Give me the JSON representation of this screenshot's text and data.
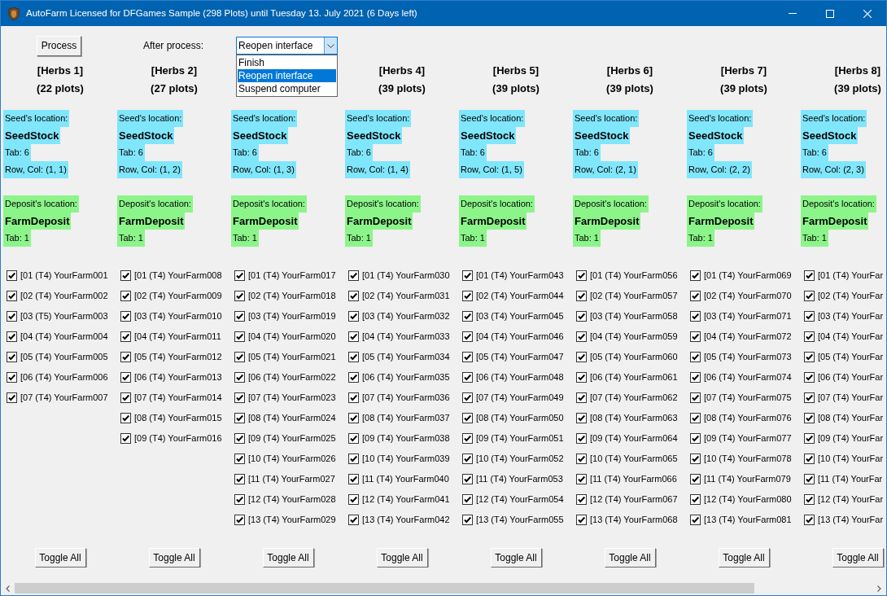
{
  "window": {
    "title": "AutoFarm Licensed for DFGames Sample (298 Plots) until Tuesday 13. July 2021 (6 Days left)"
  },
  "toolbar": {
    "process_button": "Process",
    "after_process_label": "After process:",
    "after_process_select": {
      "value": "Reopen interface",
      "expanded": true,
      "options": [
        {
          "label": "Finish",
          "selected": false
        },
        {
          "label": "Reopen interface",
          "selected": true
        },
        {
          "label": "Suspend computer",
          "selected": false
        }
      ]
    }
  },
  "columns": [
    {
      "title": "[Herbs 1]",
      "plots_count": "(22 plots)",
      "seed_location": {
        "label": "Seed's location:",
        "name": "SeedStock",
        "tab": "Tab: 6",
        "row_col": "Row, Col: (1, 1)"
      },
      "deposit_location": {
        "label": "Deposit's location:",
        "name": "FarmDeposit",
        "tab": "Tab: 1"
      },
      "plots": [
        {
          "label": "[01 (T4) YourFarm001",
          "checked": true
        },
        {
          "label": "[02 (T4) YourFarm002",
          "checked": true
        },
        {
          "label": "[03 (T5) YourFarm003",
          "checked": true
        },
        {
          "label": "[04 (T4) YourFarm004",
          "checked": true
        },
        {
          "label": "[05 (T4) YourFarm005",
          "checked": true
        },
        {
          "label": "[06 (T4) YourFarm006",
          "checked": true
        },
        {
          "label": "[07 (T4) YourFarm007",
          "checked": true
        }
      ],
      "toggle_button": "Toggle All"
    },
    {
      "title": "[Herbs 2]",
      "plots_count": "(27 plots)",
      "seed_location": {
        "label": "Seed's location:",
        "name": "SeedStock",
        "tab": "Tab: 6",
        "row_col": "Row, Col: (1, 2)"
      },
      "deposit_location": {
        "label": "Deposit's location:",
        "name": "FarmDeposit",
        "tab": "Tab: 1"
      },
      "plots": [
        {
          "label": "[01 (T4) YourFarm008",
          "checked": true
        },
        {
          "label": "[02 (T4) YourFarm009",
          "checked": true
        },
        {
          "label": "[03 (T4) YourFarm010",
          "checked": true
        },
        {
          "label": "[04 (T4) YourFarm011",
          "checked": true
        },
        {
          "label": "[05 (T4) YourFarm012",
          "checked": true
        },
        {
          "label": "[06 (T4) YourFarm013",
          "checked": true
        },
        {
          "label": "[07 (T4) YourFarm014",
          "checked": true
        },
        {
          "label": "[08 (T4) YourFarm015",
          "checked": true
        },
        {
          "label": "[09 (T4) YourFarm016",
          "checked": true
        }
      ],
      "toggle_button": "Toggle All"
    },
    {
      "seed_location": {
        "label": "Seed's location:",
        "name": "SeedStock",
        "tab": "Tab: 6",
        "row_col": "Row, Col: (1, 3)"
      },
      "deposit_location": {
        "label": "Deposit's location:",
        "name": "FarmDeposit",
        "tab": "Tab: 1"
      },
      "plots": [
        {
          "label": "[01 (T4) YourFarm017",
          "checked": true
        },
        {
          "label": "[02 (T4) YourFarm018",
          "checked": true
        },
        {
          "label": "[03 (T4) YourFarm019",
          "checked": true
        },
        {
          "label": "[04 (T4) YourFarm020",
          "checked": true
        },
        {
          "label": "[05 (T4) YourFarm021",
          "checked": true
        },
        {
          "label": "[06 (T4) YourFarm022",
          "checked": true
        },
        {
          "label": "[07 (T4) YourFarm023",
          "checked": true
        },
        {
          "label": "[08 (T4) YourFarm024",
          "checked": true
        },
        {
          "label": "[09 (T4) YourFarm025",
          "checked": true
        },
        {
          "label": "[10 (T4) YourFarm026",
          "checked": true
        },
        {
          "label": "[11 (T4) YourFarm027",
          "checked": true
        },
        {
          "label": "[12 (T4) YourFarm028",
          "checked": true
        },
        {
          "label": "[13 (T4) YourFarm029",
          "checked": true
        }
      ],
      "toggle_button": "Toggle All"
    },
    {
      "title": "[Herbs 4]",
      "plots_count": "(39 plots)",
      "seed_location": {
        "label": "Seed's location:",
        "name": "SeedStock",
        "tab": "Tab: 6",
        "row_col": "Row, Col: (1, 4)"
      },
      "deposit_location": {
        "label": "Deposit's location:",
        "name": "FarmDeposit",
        "tab": "Tab: 1"
      },
      "plots": [
        {
          "label": "[01 (T4) YourFarm030",
          "checked": true
        },
        {
          "label": "[02 (T4) YourFarm031",
          "checked": true
        },
        {
          "label": "[03 (T4) YourFarm032",
          "checked": true
        },
        {
          "label": "[04 (T4) YourFarm033",
          "checked": true
        },
        {
          "label": "[05 (T4) YourFarm034",
          "checked": true
        },
        {
          "label": "[06 (T4) YourFarm035",
          "checked": true
        },
        {
          "label": "[07 (T4) YourFarm036",
          "checked": true
        },
        {
          "label": "[08 (T4) YourFarm037",
          "checked": true
        },
        {
          "label": "[09 (T4) YourFarm038",
          "checked": true
        },
        {
          "label": "[10 (T4) YourFarm039",
          "checked": true
        },
        {
          "label": "[11 (T4) YourFarm040",
          "checked": true
        },
        {
          "label": "[12 (T4) YourFarm041",
          "checked": true
        },
        {
          "label": "[13 (T4) YourFarm042",
          "checked": true
        }
      ],
      "toggle_button": "Toggle All"
    },
    {
      "title": "[Herbs 5]",
      "plots_count": "(39 plots)",
      "seed_location": {
        "label": "Seed's location:",
        "name": "SeedStock",
        "tab": "Tab: 6",
        "row_col": "Row, Col: (1, 5)"
      },
      "deposit_location": {
        "label": "Deposit's location:",
        "name": "FarmDeposit",
        "tab": "Tab: 1"
      },
      "plots": [
        {
          "label": "[01 (T4) YourFarm043",
          "checked": true
        },
        {
          "label": "[02 (T4) YourFarm044",
          "checked": true
        },
        {
          "label": "[03 (T4) YourFarm045",
          "checked": true
        },
        {
          "label": "[04 (T4) YourFarm046",
          "checked": true
        },
        {
          "label": "[05 (T4) YourFarm047",
          "checked": true
        },
        {
          "label": "[06 (T4) YourFarm048",
          "checked": true
        },
        {
          "label": "[07 (T4) YourFarm049",
          "checked": true
        },
        {
          "label": "[08 (T4) YourFarm050",
          "checked": true
        },
        {
          "label": "[09 (T4) YourFarm051",
          "checked": true
        },
        {
          "label": "[10 (T4) YourFarm052",
          "checked": true
        },
        {
          "label": "[11 (T4) YourFarm053",
          "checked": true
        },
        {
          "label": "[12 (T4) YourFarm054",
          "checked": true
        },
        {
          "label": "[13 (T4) YourFarm055",
          "checked": true
        }
      ],
      "toggle_button": "Toggle All"
    },
    {
      "title": "[Herbs 6]",
      "plots_count": "(39 plots)",
      "seed_location": {
        "label": "Seed's location:",
        "name": "SeedStock",
        "tab": "Tab: 6",
        "row_col": "Row, Col: (2, 1)"
      },
      "deposit_location": {
        "label": "Deposit's location:",
        "name": "FarmDeposit",
        "tab": "Tab: 1"
      },
      "plots": [
        {
          "label": "[01 (T4) YourFarm056",
          "checked": true
        },
        {
          "label": "[02 (T4) YourFarm057",
          "checked": true
        },
        {
          "label": "[03 (T4) YourFarm058",
          "checked": true
        },
        {
          "label": "[04 (T4) YourFarm059",
          "checked": true
        },
        {
          "label": "[05 (T4) YourFarm060",
          "checked": true
        },
        {
          "label": "[06 (T4) YourFarm061",
          "checked": true
        },
        {
          "label": "[07 (T4) YourFarm062",
          "checked": true
        },
        {
          "label": "[08 (T4) YourFarm063",
          "checked": true
        },
        {
          "label": "[09 (T4) YourFarm064",
          "checked": true
        },
        {
          "label": "[10 (T4) YourFarm065",
          "checked": true
        },
        {
          "label": "[11 (T4) YourFarm066",
          "checked": true
        },
        {
          "label": "[12 (T4) YourFarm067",
          "checked": true
        },
        {
          "label": "[13 (T4) YourFarm068",
          "checked": true
        }
      ],
      "toggle_button": "Toggle All"
    },
    {
      "title": "[Herbs 7]",
      "plots_count": "(39 plots)",
      "seed_location": {
        "label": "Seed's location:",
        "name": "SeedStock",
        "tab": "Tab: 6",
        "row_col": "Row, Col: (2, 2)"
      },
      "deposit_location": {
        "label": "Deposit's location:",
        "name": "FarmDeposit",
        "tab": "Tab: 1"
      },
      "plots": [
        {
          "label": "[01 (T4) YourFarm069",
          "checked": true
        },
        {
          "label": "[02 (T4) YourFarm070",
          "checked": true
        },
        {
          "label": "[03 (T4) YourFarm071",
          "checked": true
        },
        {
          "label": "[04 (T4) YourFarm072",
          "checked": true
        },
        {
          "label": "[05 (T4) YourFarm073",
          "checked": true
        },
        {
          "label": "[06 (T4) YourFarm074",
          "checked": true
        },
        {
          "label": "[07 (T4) YourFarm075",
          "checked": true
        },
        {
          "label": "[08 (T4) YourFarm076",
          "checked": true
        },
        {
          "label": "[09 (T4) YourFarm077",
          "checked": true
        },
        {
          "label": "[10 (T4) YourFarm078",
          "checked": true
        },
        {
          "label": "[11 (T4) YourFarm079",
          "checked": true
        },
        {
          "label": "[12 (T4) YourFarm080",
          "checked": true
        },
        {
          "label": "[13 (T4) YourFarm081",
          "checked": true
        }
      ],
      "toggle_button": "Toggle All"
    },
    {
      "title": "[Herbs 8]",
      "plots_count": "(39 plots)",
      "seed_location": {
        "label": "Seed's location:",
        "name": "SeedStock",
        "tab": "Tab: 6",
        "row_col": "Row, Col: (2, 3)"
      },
      "deposit_location": {
        "label": "Deposit's location:",
        "name": "FarmDeposit",
        "tab": "Tab: 1"
      },
      "plots": [
        {
          "label": "[01 (T4) YourFar",
          "checked": true
        },
        {
          "label": "[02 (T4) YourFar",
          "checked": true
        },
        {
          "label": "[03 (T4) YourFar",
          "checked": true
        },
        {
          "label": "[04 (T4) YourFar",
          "checked": true
        },
        {
          "label": "[05 (T4) YourFar",
          "checked": true
        },
        {
          "label": "[06 (T4) YourFar",
          "checked": true
        },
        {
          "label": "[07 (T4) YourFar",
          "checked": true
        },
        {
          "label": "[08 (T4) YourFar",
          "checked": true
        },
        {
          "label": "[09 (T4) YourFar",
          "checked": true
        },
        {
          "label": "[10 (T4) YourFar",
          "checked": true
        },
        {
          "label": "[11 (T4) YourFar",
          "checked": true
        },
        {
          "label": "[12 (T4) YourFar",
          "checked": true
        },
        {
          "label": "[13 (T4) YourFar",
          "checked": true
        }
      ],
      "toggle_button": "Toggle All"
    }
  ]
}
